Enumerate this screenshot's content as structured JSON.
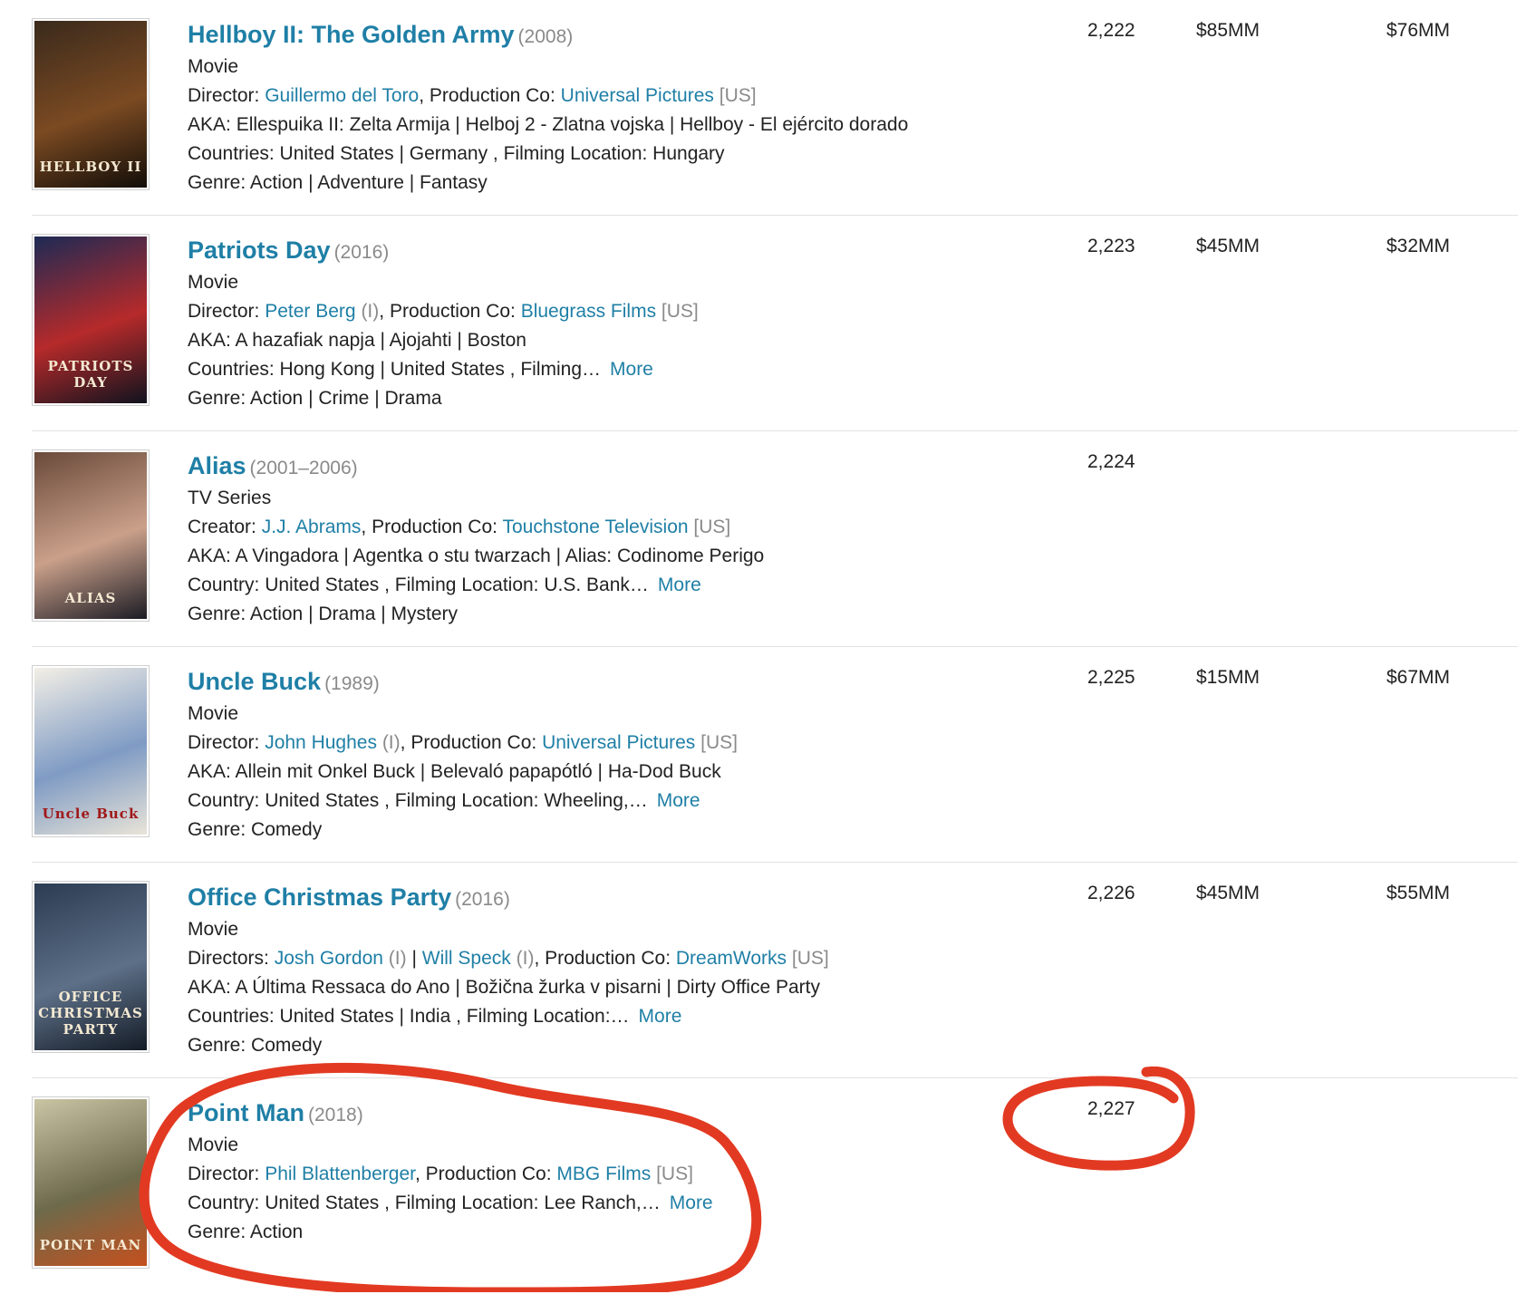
{
  "colors": {
    "link": "#1f7fa6",
    "muted": "#8a8a8a",
    "annotation": "#e23a22"
  },
  "rows": [
    {
      "title": "Hellboy II: The Golden Army",
      "year": "(2008)",
      "kind": "Movie",
      "director_label": "Director:",
      "directors": [
        {
          "name": "Guillermo del Toro",
          "suffix": ""
        }
      ],
      "prod_label": "Production Co:",
      "prod_co": "Universal Pictures",
      "prod_country": "[US]",
      "aka": "AKA: Ellespuika II: Zelta Armija | Helboj 2 - Zlatna vojska | Hellboy - El ejército dorado",
      "countries": "Countries: United States | Germany , Filming Location: Hungary",
      "more": "",
      "genre": "Genre: Action | Adventure | Fantasy",
      "rank": "2,222",
      "budget": "$85MM",
      "gross": "$76MM",
      "poster_caption": "HELLBOY II",
      "poster_colors": [
        "#3a2a1c",
        "#7b4a22",
        "#120d08"
      ]
    },
    {
      "title": "Patriots Day",
      "year": "(2016)",
      "kind": "Movie",
      "director_label": "Director:",
      "directors": [
        {
          "name": "Peter Berg",
          "suffix": "(I)"
        }
      ],
      "prod_label": "Production Co:",
      "prod_co": "Bluegrass Films",
      "prod_country": "[US]",
      "aka": "AKA: A hazafiak napja | Ajojahti | Boston",
      "countries": "Countries: Hong Kong | United States , Filming…",
      "more": "More",
      "genre": "Genre: Action | Crime | Drama",
      "rank": "2,223",
      "budget": "$45MM",
      "gross": "$32MM",
      "poster_caption": "PATRIOTS DAY",
      "poster_colors": [
        "#1d2a55",
        "#b62a2a",
        "#10131e"
      ]
    },
    {
      "title": "Alias",
      "year": "(2001–2006)",
      "kind": "TV Series",
      "director_label": "Creator:",
      "directors": [
        {
          "name": "J.J. Abrams",
          "suffix": ""
        }
      ],
      "prod_label": "Production Co:",
      "prod_co": "Touchstone Television",
      "prod_country": "[US]",
      "aka": "AKA: A Vingadora | Agentka o stu twarzach | Alias: Codinome Perigo",
      "countries": "Country: United States , Filming Location: U.S. Bank…",
      "more": "More",
      "genre": "Genre: Action | Drama | Mystery",
      "rank": "2,224",
      "budget": "",
      "gross": "",
      "poster_caption": "ALIAS",
      "poster_colors": [
        "#6a4a3a",
        "#caa08a",
        "#1b1b24"
      ]
    },
    {
      "title": "Uncle Buck",
      "year": "(1989)",
      "kind": "Movie",
      "director_label": "Director:",
      "directors": [
        {
          "name": "John Hughes",
          "suffix": "(I)"
        }
      ],
      "prod_label": "Production Co:",
      "prod_co": "Universal Pictures",
      "prod_country": "[US]",
      "aka": "AKA: Allein mit Onkel Buck | Belevaló papapótló | Ha-Dod Buck",
      "countries": "Country: United States , Filming Location: Wheeling,…",
      "more": "More",
      "genre": "Genre: Comedy",
      "rank": "2,225",
      "budget": "$15MM",
      "gross": "$67MM",
      "poster_caption": "Uncle Buck",
      "poster_colors": [
        "#f3efe6",
        "#7f9bc4",
        "#e9e4d8"
      ]
    },
    {
      "title": "Office Christmas Party",
      "year": "(2016)",
      "kind": "Movie",
      "director_label": "Directors:",
      "directors": [
        {
          "name": "Josh Gordon",
          "suffix": "(I)"
        },
        {
          "name": "Will Speck",
          "suffix": "(I)"
        }
      ],
      "prod_label": "Production Co:",
      "prod_co": "DreamWorks",
      "prod_country": "[US]",
      "aka": "AKA: A Última Ressaca do Ano | Božična žurka v pisarni | Dirty Office Party",
      "countries": "Countries: United States | India , Filming Location:…",
      "more": "More",
      "genre": "Genre: Comedy",
      "rank": "2,226",
      "budget": "$45MM",
      "gross": "$55MM",
      "poster_caption": "OFFICE CHRISTMAS PARTY",
      "poster_colors": [
        "#2c3c52",
        "#5d7088",
        "#141b26"
      ]
    },
    {
      "title": "Point Man",
      "year": "(2018)",
      "kind": "Movie",
      "director_label": "Director:",
      "directors": [
        {
          "name": "Phil Blattenberger",
          "suffix": ""
        }
      ],
      "prod_label": "Production Co:",
      "prod_co": "MBG Films",
      "prod_country": "[US]",
      "aka": "",
      "countries": "Country: United States , Filming Location: Lee Ranch,…",
      "more": "More",
      "genre": "Genre: Action",
      "rank": "2,227",
      "budget": "",
      "gross": "",
      "poster_caption": "POINT MAN",
      "poster_colors": [
        "#c9c4a4",
        "#6d6a4b",
        "#c4501e"
      ]
    }
  ]
}
